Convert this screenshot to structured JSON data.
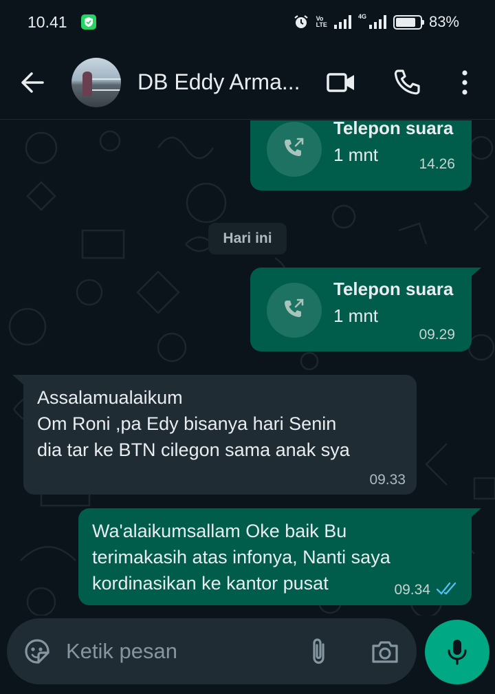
{
  "status_bar": {
    "time": "10.41",
    "volte_line1": "Vo",
    "volte_line2": "LTE",
    "network": "4G",
    "battery": "83%",
    "battery_level": 0.83
  },
  "header": {
    "contact_name": "DB Eddy Arma..."
  },
  "chat": {
    "call_1": {
      "title": "Telepon suara",
      "duration": "1 mnt",
      "time": "14.26"
    },
    "date_chip": "Hari ini",
    "call_2": {
      "title": "Telepon suara",
      "duration": "1 mnt",
      "time": "09.29"
    },
    "incoming_message": {
      "text": "Assalamualaikum\nOm Roni ,pa Edy bisanya hari Senin\ndia tar ke BTN cilegon sama anak sya",
      "time": "09.33"
    },
    "outgoing_message": {
      "text": "Wa'alaikumsallam Oke baik Bu\nterimakasih atas infonya, Nanti saya\nkordinasikan ke kantor pusat",
      "time": "09.34",
      "status": "read"
    }
  },
  "input": {
    "placeholder": "Ketik pesan"
  },
  "colors": {
    "background": "#0b141a",
    "outgoing_bubble": "#005c4b",
    "incoming_bubble": "#202c33",
    "accent": "#00a884",
    "read_ticks": "#53bdeb"
  }
}
